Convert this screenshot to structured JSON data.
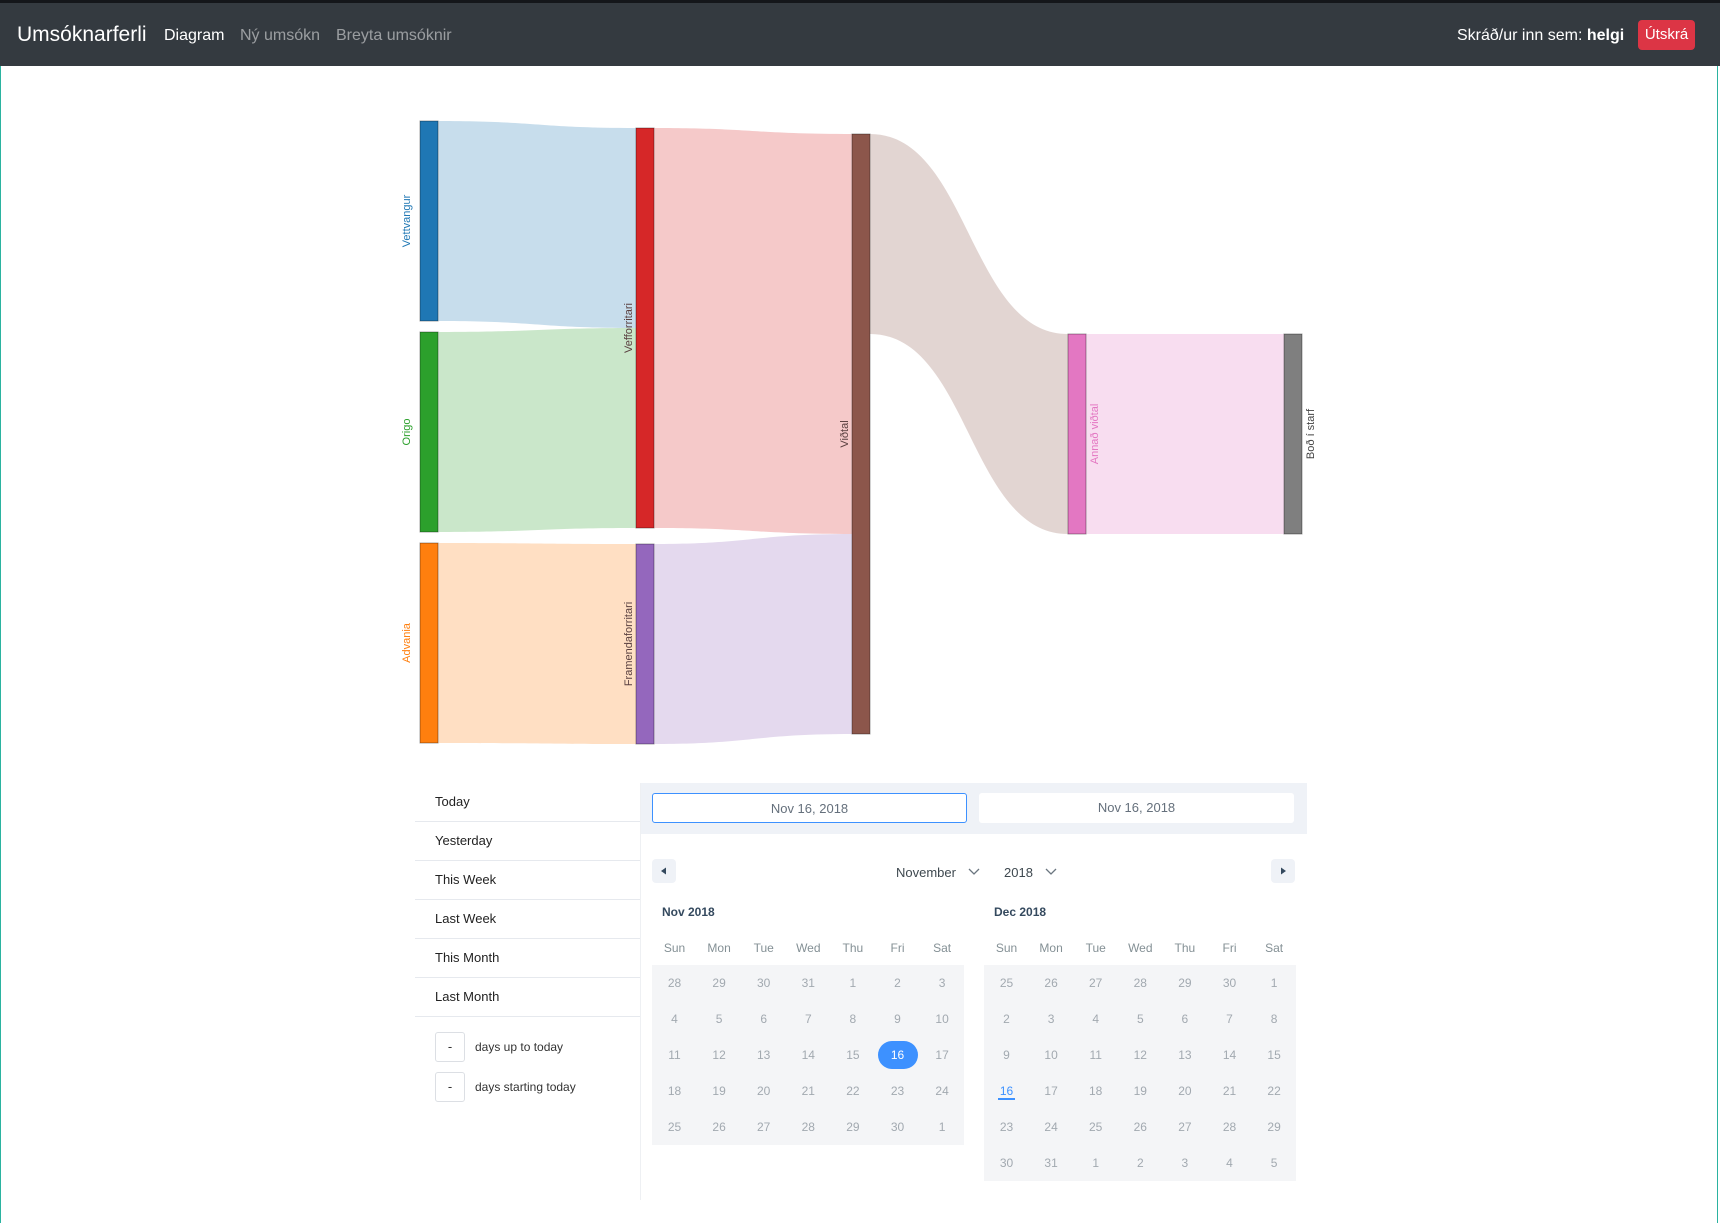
{
  "navbar": {
    "brand": "Umsóknarferli",
    "links": [
      "Diagram",
      "Ný umsókn",
      "Breyta umsóknir"
    ],
    "logged_prefix": "Skráð/ur inn sem:",
    "username": "helgi",
    "logout_label": "Útskrá"
  },
  "chart_data": {
    "type": "sankey",
    "nodes": [
      {
        "name": "Vettvangur",
        "color": "#1f77b4"
      },
      {
        "name": "Origo",
        "color": "#2ca02c"
      },
      {
        "name": "Advania",
        "color": "#ff7f0e"
      },
      {
        "name": "Vefforritari",
        "color": "#d62728"
      },
      {
        "name": "Framendaforritari",
        "color": "#9467bd"
      },
      {
        "name": "Viðtal",
        "color": "#8c564b"
      },
      {
        "name": "Annað viðtal",
        "color": "#e377c2"
      },
      {
        "name": "Boð í starf",
        "color": "#7f7f7f"
      }
    ],
    "links": [
      {
        "source": "Vettvangur",
        "target": "Vefforritari",
        "value": 1
      },
      {
        "source": "Origo",
        "target": "Vefforritari",
        "value": 1
      },
      {
        "source": "Advania",
        "target": "Framendaforritari",
        "value": 1
      },
      {
        "source": "Vefforritari",
        "target": "Viðtal",
        "value": 2
      },
      {
        "source": "Framendaforritari",
        "target": "Viðtal",
        "value": 1
      },
      {
        "source": "Viðtal",
        "target": "Annað viðtal",
        "value": 1
      },
      {
        "source": "Annað viðtal",
        "target": "Boð í starf",
        "value": 1
      }
    ]
  },
  "static_ranges": [
    "Today",
    "Yesterday",
    "This Week",
    "Last Week",
    "This Month",
    "Last Month"
  ],
  "input_ranges": [
    {
      "value": "-",
      "label": "days up to today"
    },
    {
      "value": "-",
      "label": "days starting today"
    }
  ],
  "date_display": {
    "start": "Nov 16, 2018",
    "end": "Nov 16, 2018"
  },
  "month_select": "November",
  "year_select": "2018",
  "weekdays": [
    "Sun",
    "Mon",
    "Tue",
    "Wed",
    "Thu",
    "Fri",
    "Sat"
  ],
  "months": [
    {
      "name": "Nov 2018",
      "weeks": [
        [
          "28",
          "29",
          "30",
          "31",
          "1",
          "2",
          "3"
        ],
        [
          "4",
          "5",
          "6",
          "7",
          "8",
          "9",
          "10"
        ],
        [
          "11",
          "12",
          "13",
          "14",
          "15",
          "16",
          "17"
        ],
        [
          "18",
          "19",
          "20",
          "21",
          "22",
          "23",
          "24"
        ],
        [
          "25",
          "26",
          "27",
          "28",
          "29",
          "30",
          "1"
        ]
      ],
      "selected_day": "16"
    },
    {
      "name": "Dec 2018",
      "weeks": [
        [
          "25",
          "26",
          "27",
          "28",
          "29",
          "30",
          "1"
        ],
        [
          "2",
          "3",
          "4",
          "5",
          "6",
          "7",
          "8"
        ],
        [
          "9",
          "10",
          "11",
          "12",
          "13",
          "14",
          "15"
        ],
        [
          "16",
          "17",
          "18",
          "19",
          "20",
          "21",
          "22"
        ],
        [
          "23",
          "24",
          "25",
          "26",
          "27",
          "28",
          "29"
        ],
        [
          "30",
          "31",
          "1",
          "2",
          "3",
          "4",
          "5"
        ]
      ],
      "today_day": "16"
    }
  ]
}
